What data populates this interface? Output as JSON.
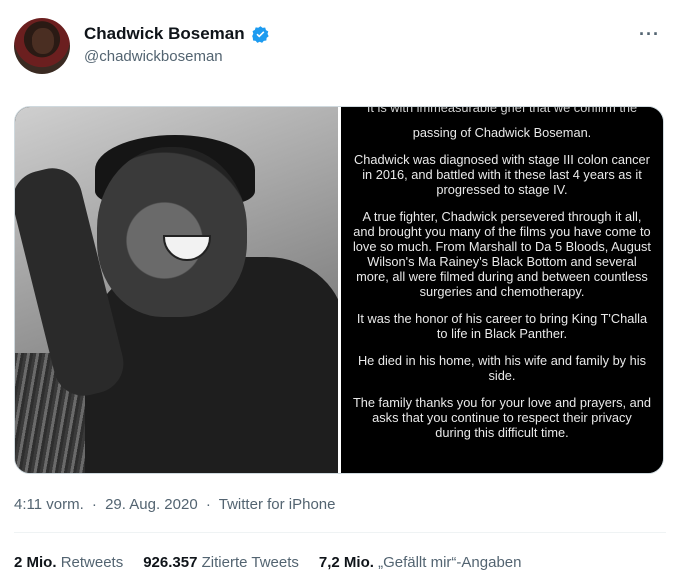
{
  "author": {
    "name": "Chadwick Boseman",
    "handle": "@chadwickboseman",
    "verified": true
  },
  "colors": {
    "verified_badge": "#1d9bf0",
    "text_primary": "#0f1419",
    "text_secondary": "#536471"
  },
  "more_menu": "···",
  "statement": {
    "cutoff_line": "It is with immeasurable grief that we confirm the",
    "paragraphs": [
      "passing of Chadwick Boseman.",
      "Chadwick was diagnosed with stage III colon cancer in 2016, and battled with it these last 4 years as it progressed to stage IV.",
      "A true fighter, Chadwick persevered through it all, and brought you many of the films you have come to love so much. From Marshall to Da 5 Bloods, August Wilson's Ma Rainey's Black Bottom and several more, all were filmed during and between countless surgeries and chemotherapy.",
      "It was the honor of his career to bring King T'Challa to life in Black Panther.",
      "He died in his home, with his wife and family by his side.",
      "The family thanks you for your love and prayers, and asks that you continue to respect their privacy during this difficult time."
    ]
  },
  "meta": {
    "time": "4:11 vorm.",
    "sep1": "·",
    "date": "29. Aug. 2020",
    "sep2": "·",
    "source": "Twitter for iPhone"
  },
  "stats": {
    "retweets_count": "2 Mio.",
    "retweets_label": "Retweets",
    "quotes_count": "926.357",
    "quotes_label": "Zitierte Tweets",
    "likes_count": "7,2 Mio.",
    "likes_label": "„Gefällt mir“-Angaben"
  }
}
